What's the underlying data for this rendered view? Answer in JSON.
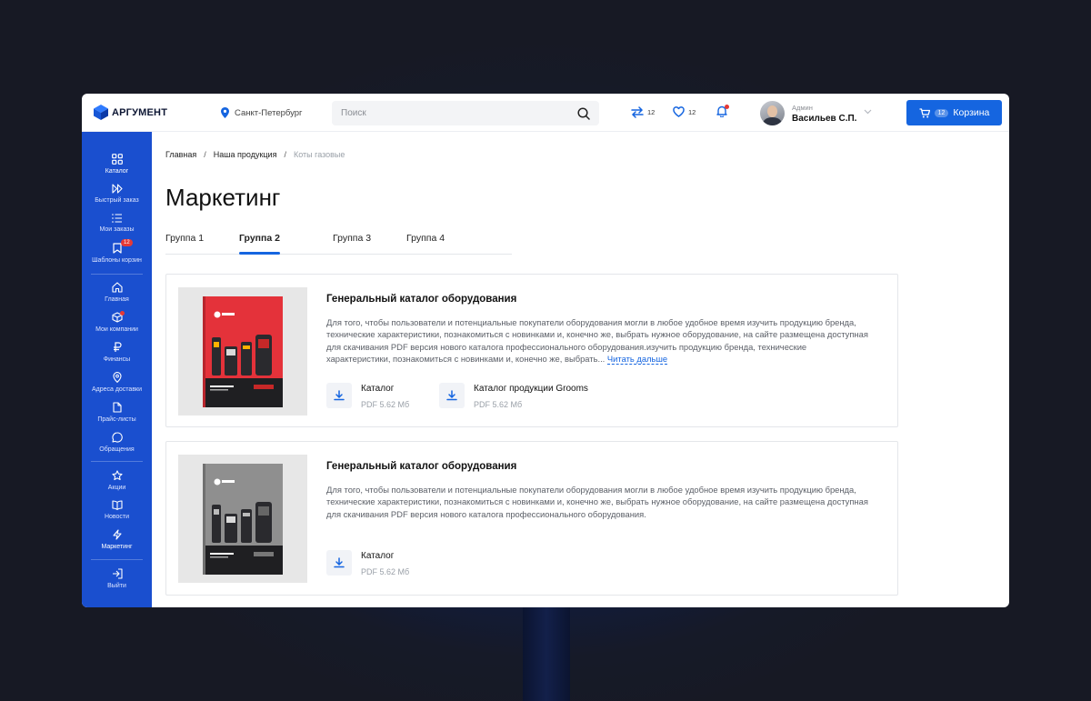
{
  "header": {
    "logo_text": "АРГУМЕНТ",
    "city": "Санкт-Петербург",
    "search_placeholder": "Поиск",
    "compare_count": "12",
    "favorites_count": "12",
    "user_role": "Админ",
    "user_name": "Васильев С.П.",
    "cart_count": "12",
    "cart_label": "Корзина"
  },
  "sidebar": {
    "items": [
      {
        "label": "Каталог",
        "icon": "grid-icon"
      },
      {
        "label": "Быстрый заказ",
        "icon": "fast-forward-icon"
      },
      {
        "label": "Мои заказы",
        "icon": "list-icon"
      },
      {
        "label": "Шаблоны корзин",
        "icon": "bookmark-icon",
        "badge": "12"
      },
      {
        "label": "Главная",
        "icon": "home-icon"
      },
      {
        "label": "Мои компании",
        "icon": "box-icon"
      },
      {
        "label": "Финансы",
        "icon": "ruble-icon"
      },
      {
        "label": "Адреса доставки",
        "icon": "location-icon"
      },
      {
        "label": "Прайс-листы",
        "icon": "file-icon"
      },
      {
        "label": "Обращения",
        "icon": "chat-icon"
      },
      {
        "label": "Акции",
        "icon": "star-icon"
      },
      {
        "label": "Новости",
        "icon": "book-icon"
      },
      {
        "label": "Маркетинг",
        "icon": "bolt-icon"
      },
      {
        "label": "Выйти",
        "icon": "logout-icon"
      }
    ]
  },
  "breadcrumb": {
    "items": [
      "Главная",
      "Наша продукция",
      "Коты газовые"
    ],
    "separator": "/"
  },
  "page_title": "Маркетинг",
  "tabs": [
    "Группа 1",
    "Группа 2",
    "Группа 3",
    "Группа 4"
  ],
  "active_tab": "Группа 2",
  "cards": [
    {
      "title": "Генеральный каталог оборудования",
      "description": "Для того, чтобы пользователи и потенциальные покупатели оборудования могли в любое удобное время изучить продукцию бренда, технические характеристики, познакомиться с новинками и, конечно же, выбрать нужное оборудование, на сайте размещена доступная для скачивания PDF версия нового каталога профессионального оборудования.изучить продукцию бренда, технические характеристики, познакомиться с новинками и, конечно же, выбрать...",
      "read_more": "Читать дальше",
      "cover_color": "#e4323a",
      "downloads": [
        {
          "name": "Каталог",
          "meta": "PDF 5.62 Мб"
        },
        {
          "name": "Каталог продукции Grooms",
          "meta": "PDF 5.62 Мб"
        }
      ]
    },
    {
      "title": "Генеральный каталог оборудования",
      "description": "Для того, чтобы пользователи и потенциальные покупатели оборудования могли в любое удобное время изучить продукцию бренда, технические характеристики, познакомиться с новинками и, конечно же, выбрать нужное оборудование, на сайте размещена доступная для скачивания PDF версия нового каталога профессионального оборудования.",
      "cover_color": "#8f8f8f",
      "downloads": [
        {
          "name": "Каталог",
          "meta": "PDF 5.62 Мб"
        }
      ]
    }
  ],
  "colors": {
    "accent": "#1565e0",
    "sidebar": "#1a4fcf",
    "notification": "#e53935"
  }
}
